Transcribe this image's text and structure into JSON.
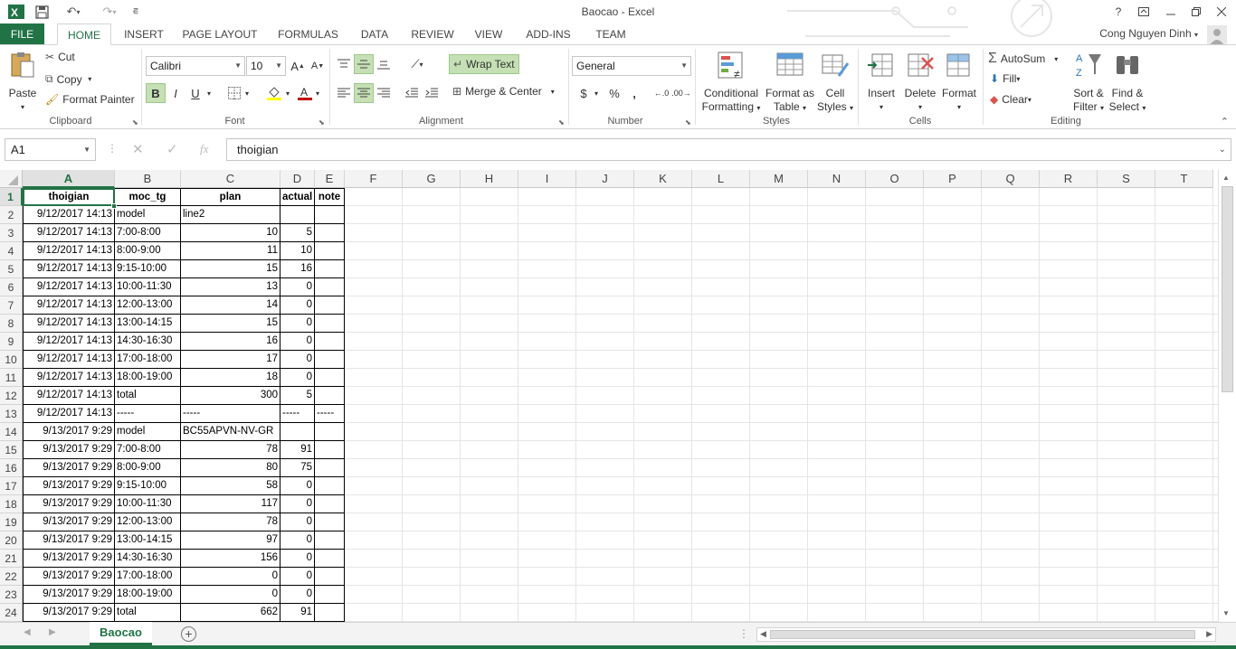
{
  "window": {
    "title": "Baocao - Excel",
    "help": "?",
    "user": "Cong Nguyen Dinh"
  },
  "tabs": [
    "FILE",
    "HOME",
    "INSERT",
    "PAGE LAYOUT",
    "FORMULAS",
    "DATA",
    "REVIEW",
    "VIEW",
    "ADD-INS",
    "TEAM"
  ],
  "clipboard": {
    "paste": "Paste",
    "cut": "Cut",
    "copy": "Copy",
    "format_painter": "Format Painter",
    "label": "Clipboard"
  },
  "font": {
    "name": "Calibri",
    "size": "10",
    "bold": "B",
    "italic": "I",
    "underline": "U",
    "label": "Font"
  },
  "alignment": {
    "wrap": "Wrap Text",
    "merge": "Merge & Center",
    "label": "Alignment"
  },
  "number": {
    "format": "General",
    "currency": "$",
    "percent": "%",
    "comma": ",",
    "label": "Number"
  },
  "styles": {
    "cond1": "Conditional",
    "cond2": "Formatting",
    "fmt1": "Format as",
    "fmt2": "Table",
    "cell1": "Cell",
    "cell2": "Styles",
    "label": "Styles"
  },
  "cells": {
    "insert": "Insert",
    "delete": "Delete",
    "format": "Format",
    "label": "Cells"
  },
  "editing": {
    "autosum": "AutoSum",
    "fill": "Fill",
    "clear": "Clear",
    "sort1": "Sort &",
    "sort2": "Filter",
    "find1": "Find &",
    "find2": "Select",
    "label": "Editing"
  },
  "formula_bar": {
    "name_box": "A1",
    "fx": "fx",
    "value": "thoigian"
  },
  "columns": [
    "A",
    "B",
    "C",
    "D",
    "E",
    "F",
    "G",
    "H",
    "I",
    "J",
    "K",
    "L",
    "M",
    "N",
    "O",
    "P",
    "Q",
    "R",
    "S",
    "T"
  ],
  "rows": [
    [
      "thoigian",
      "moc_tg",
      "plan",
      "actual",
      "note"
    ],
    [
      "9/12/2017 14:13",
      "model",
      "line2",
      "",
      ""
    ],
    [
      "9/12/2017 14:13",
      "7:00-8:00",
      "10",
      "5",
      ""
    ],
    [
      "9/12/2017 14:13",
      "8:00-9:00",
      "11",
      "10",
      ""
    ],
    [
      "9/12/2017 14:13",
      "9:15-10:00",
      "15",
      "16",
      ""
    ],
    [
      "9/12/2017 14:13",
      "10:00-11:30",
      "13",
      "0",
      ""
    ],
    [
      "9/12/2017 14:13",
      "12:00-13:00",
      "14",
      "0",
      ""
    ],
    [
      "9/12/2017 14:13",
      "13:00-14:15",
      "15",
      "0",
      ""
    ],
    [
      "9/12/2017 14:13",
      "14:30-16:30",
      "16",
      "0",
      ""
    ],
    [
      "9/12/2017 14:13",
      "17:00-18:00",
      "17",
      "0",
      ""
    ],
    [
      "9/12/2017 14:13",
      "18:00-19:00",
      "18",
      "0",
      ""
    ],
    [
      "9/12/2017 14:13",
      "total",
      "300",
      "5",
      ""
    ],
    [
      "9/12/2017 14:13",
      "-----",
      "-----",
      "-----",
      "-----"
    ],
    [
      "9/13/2017 9:29",
      "model",
      "BC55APVN-NV-GR",
      "",
      ""
    ],
    [
      "9/13/2017 9:29",
      "7:00-8:00",
      "78",
      "91",
      ""
    ],
    [
      "9/13/2017 9:29",
      "8:00-9:00",
      "80",
      "75",
      ""
    ],
    [
      "9/13/2017 9:29",
      "9:15-10:00",
      "58",
      "0",
      ""
    ],
    [
      "9/13/2017 9:29",
      "10:00-11:30",
      "117",
      "0",
      ""
    ],
    [
      "9/13/2017 9:29",
      "12:00-13:00",
      "78",
      "0",
      ""
    ],
    [
      "9/13/2017 9:29",
      "13:00-14:15",
      "97",
      "0",
      ""
    ],
    [
      "9/13/2017 9:29",
      "14:30-16:30",
      "156",
      "0",
      ""
    ],
    [
      "9/13/2017 9:29",
      "17:00-18:00",
      "0",
      "0",
      ""
    ],
    [
      "9/13/2017 9:29",
      "18:00-19:00",
      "0",
      "0",
      ""
    ],
    [
      "9/13/2017 9:29",
      "total",
      "662",
      "91",
      ""
    ]
  ],
  "sheet_tab": "Baocao",
  "colors": {
    "accent": "#217346",
    "selected_fill": "#c5e0b4"
  }
}
